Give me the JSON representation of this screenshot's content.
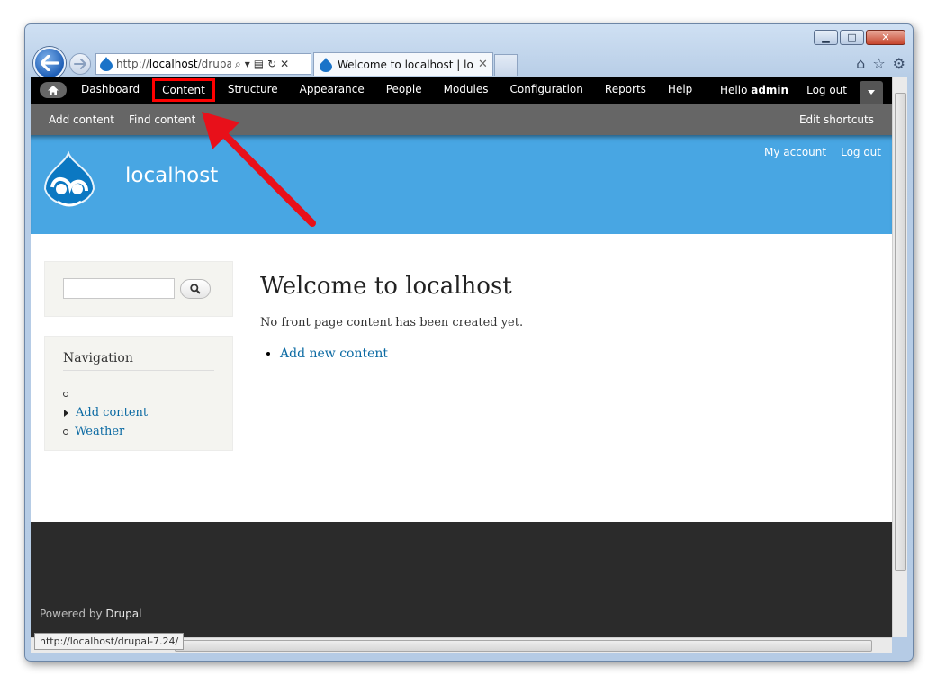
{
  "browser": {
    "address": {
      "prefix": "http://",
      "host": "localhost",
      "path": "/drupal-"
    },
    "tab_title": "Welcome to localhost | loc...",
    "tab_close": "✕",
    "status_url": "http://localhost/drupal-7.24/",
    "icons": [
      "back-icon",
      "forward-icon",
      "search-icon",
      "compat-icon",
      "refresh-icon",
      "stop-icon",
      "home-icon",
      "star-icon",
      "gear-icon"
    ]
  },
  "toolbar": {
    "menu": [
      {
        "label": "Dashboard"
      },
      {
        "label": "Content",
        "highlighted": true
      },
      {
        "label": "Structure"
      },
      {
        "label": "Appearance"
      },
      {
        "label": "People"
      },
      {
        "label": "Modules"
      },
      {
        "label": "Configuration"
      },
      {
        "label": "Reports"
      },
      {
        "label": "Help"
      }
    ],
    "hello": "Hello ",
    "username": "admin",
    "logout": "Log out"
  },
  "shortcuts": {
    "items": [
      "Add content",
      "Find content"
    ],
    "edit": "Edit shortcuts"
  },
  "header": {
    "site_name": "localhost",
    "secondary": [
      "My account",
      "Log out"
    ]
  },
  "navigation": {
    "title": "Navigation",
    "items": [
      {
        "label": "",
        "bullet": "circle"
      },
      {
        "label": "Add content",
        "bullet": "triangle"
      },
      {
        "label": "Weather",
        "bullet": "circle"
      }
    ]
  },
  "main": {
    "title": "Welcome to localhost",
    "message": "No front page content has been created yet.",
    "link": "Add new content"
  },
  "footer": {
    "powered_by": "Powered by ",
    "drupal": "Drupal"
  },
  "colors": {
    "header_blue": "#48a6e3",
    "toolbar_black": "#000000",
    "shortcut_gray": "#666666",
    "footer_dark": "#2b2b2b",
    "link_blue": "#0b6aa3",
    "highlight_red": "#ff0000"
  }
}
